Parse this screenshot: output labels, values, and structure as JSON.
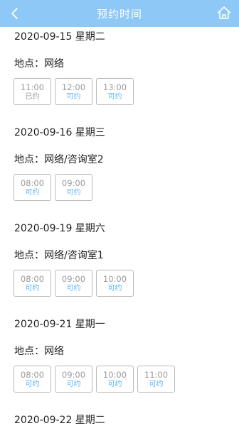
{
  "header": {
    "title": "预约时间"
  },
  "colors": {
    "navbar": "#8ec8f7",
    "available": "#5fb2f0",
    "booked": "#9a9a9a"
  },
  "icons": {
    "back": "back-arrow-icon",
    "home": "home-icon"
  },
  "days": [
    {
      "date": "2020-09-15 星期二",
      "location": "地点：网络",
      "slots": [
        {
          "time": "11:00",
          "status": "已约"
        },
        {
          "time": "12:00",
          "status": "可约"
        },
        {
          "time": "13:00",
          "status": "可约"
        }
      ]
    },
    {
      "date": "2020-09-16 星期三",
      "location": "地点：网络/咨询室2",
      "slots": [
        {
          "time": "08:00",
          "status": "可约"
        },
        {
          "time": "09:00",
          "status": "可约"
        }
      ]
    },
    {
      "date": "2020-09-19 星期六",
      "location": "地点：网络/咨询室1",
      "slots": [
        {
          "time": "08:00",
          "status": "可约"
        },
        {
          "time": "09:00",
          "status": "可约"
        },
        {
          "time": "10:00",
          "status": "可约"
        }
      ]
    },
    {
      "date": "2020-09-21 星期一",
      "location": "地点：网络",
      "slots": [
        {
          "time": "08:00",
          "status": "可约"
        },
        {
          "time": "09:00",
          "status": "可约"
        },
        {
          "time": "10:00",
          "status": "可约"
        },
        {
          "time": "11:00",
          "status": "可约"
        }
      ]
    },
    {
      "date": "2020-09-22 星期二"
    }
  ]
}
